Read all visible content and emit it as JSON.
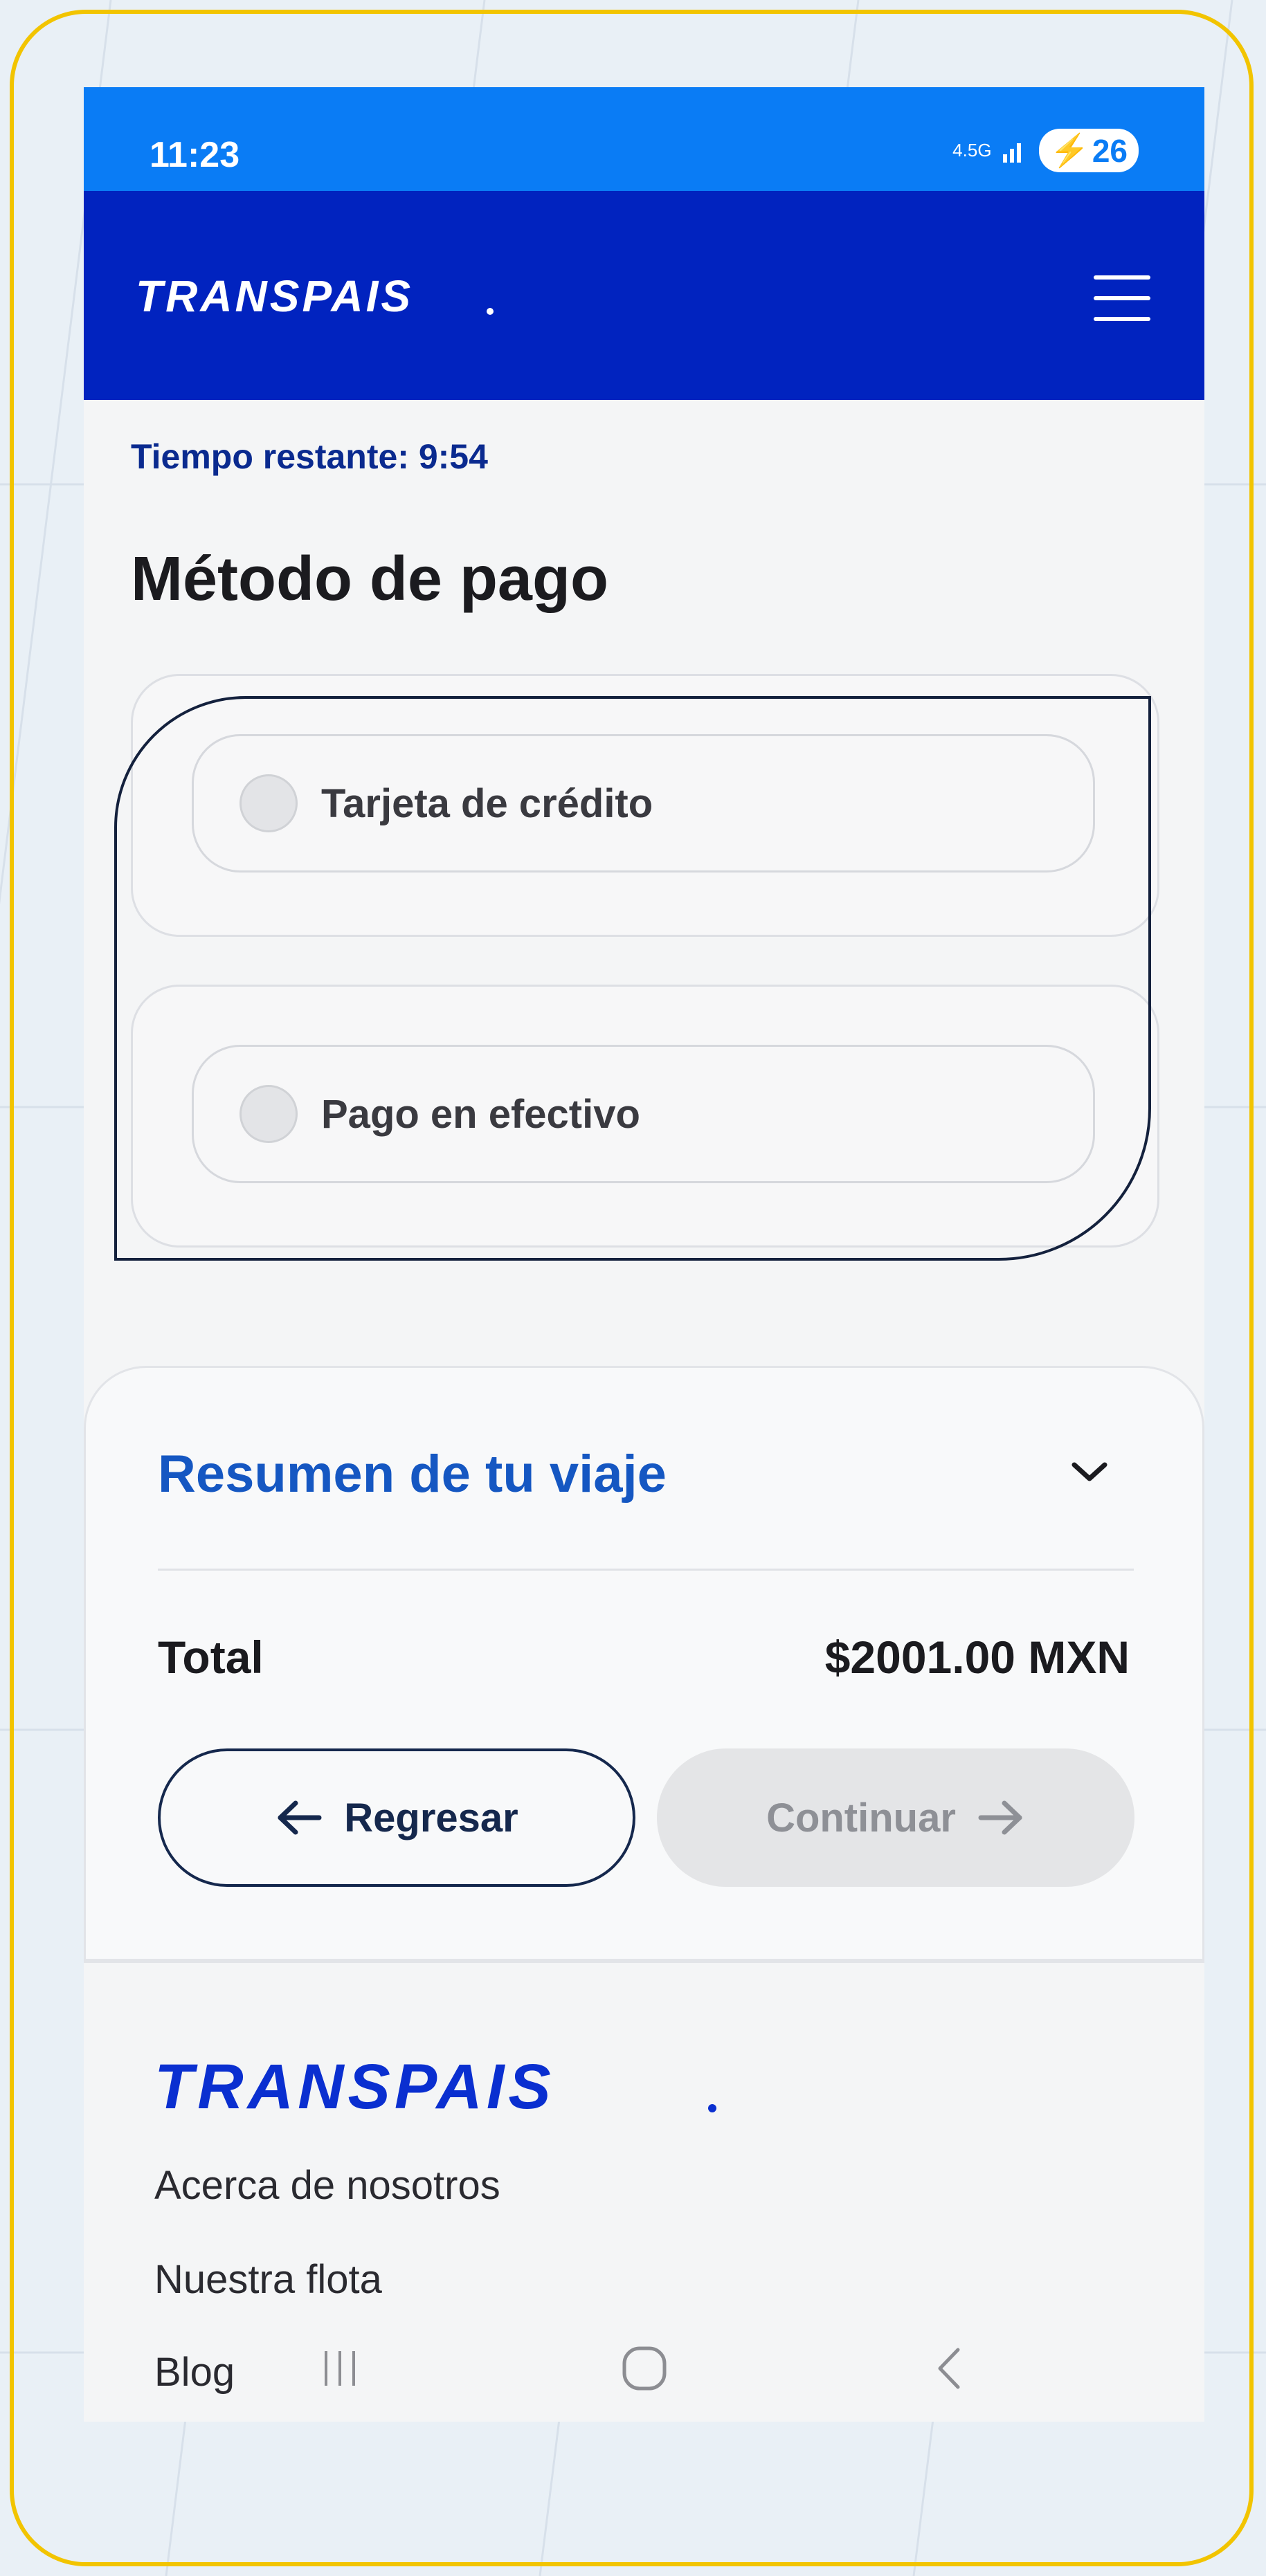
{
  "status_bar": {
    "time": "11:23",
    "network": "4.5G",
    "battery": "26"
  },
  "header": {
    "brand": "TRANSPAIS"
  },
  "timer": {
    "text": "Tiempo restante: 9:54"
  },
  "page": {
    "title": "Método de pago"
  },
  "payment_options": [
    {
      "label": "Tarjeta de crédito",
      "selected": false
    },
    {
      "label": "Pago en efectivo",
      "selected": false
    }
  ],
  "summary": {
    "title": "Resumen de tu viaje",
    "total_label": "Total",
    "total_value": "$2001.00 MXN",
    "back_label": "Regresar",
    "continue_label": "Continuar"
  },
  "footer": {
    "brand": "TRANSPAIS",
    "links": [
      "Acerca de nosotros",
      "Nuestra flota",
      "Blog"
    ]
  },
  "colors": {
    "status_bar": "#0a7cf5",
    "header": "#0123bf",
    "accent_blue": "#1557c2",
    "frame": "#f2c400"
  }
}
